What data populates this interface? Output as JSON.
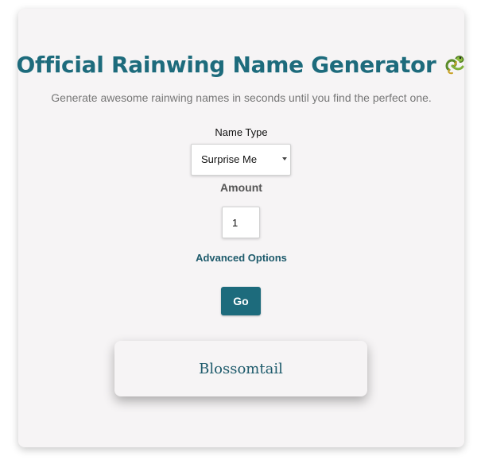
{
  "header": {
    "title": "Official Rainwing Name Generator",
    "subtitle": "Generate awesome rainwing names in seconds until you find the perfect one.",
    "title_icon": "dragon-icon"
  },
  "form": {
    "name_type_label": "Name Type",
    "name_type_selected": "Surprise Me",
    "amount_label": "Amount",
    "amount_value": "1",
    "advanced_options_label": "Advanced Options",
    "go_label": "Go"
  },
  "result": {
    "names": [
      "Blossomtail"
    ]
  },
  "colors": {
    "accent": "#1d6b7c",
    "card_background": "#f6f4f5",
    "subtitle_text": "#777777"
  }
}
